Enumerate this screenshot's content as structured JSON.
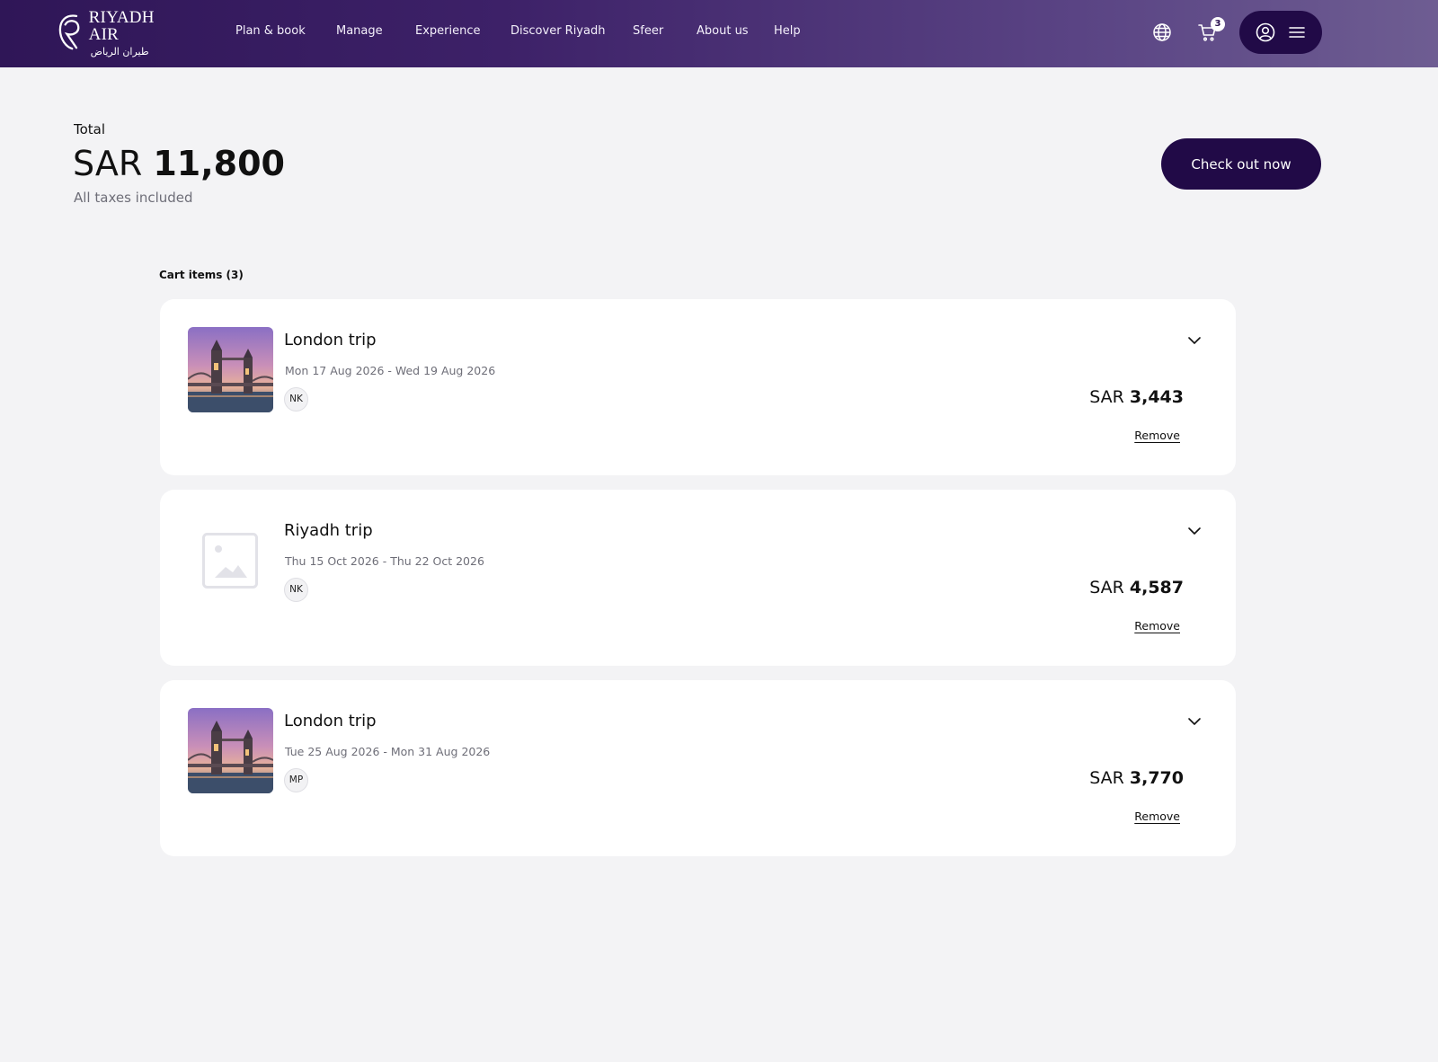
{
  "header": {
    "logo_text": "RIYADH AIR",
    "logo_arabic": "طيران الرياض",
    "nav": [
      {
        "label": "Plan & book"
      },
      {
        "label": "Manage"
      },
      {
        "label": "Experience"
      },
      {
        "label": "Discover Riyadh"
      },
      {
        "label": "Sfeer"
      },
      {
        "label": "About us"
      },
      {
        "label": "Help"
      }
    ],
    "cart_count": "3",
    "icons": [
      "globe-icon",
      "cart-icon",
      "user-icon",
      "menu-icon"
    ]
  },
  "summary": {
    "total_label": "Total",
    "currency": "SAR",
    "total_amount": "11,800",
    "taxes_note": "All taxes included",
    "checkout_label": "Check out now"
  },
  "cart": {
    "title": "Cart items (3)",
    "items": [
      {
        "name": "London trip",
        "dates": "Mon 17 Aug 2026 - Wed 19 Aug 2026",
        "traveler": "NK",
        "currency": "SAR",
        "price": "3,443",
        "remove_label": "Remove",
        "image": "tower-bridge-photo"
      },
      {
        "name": "Riyadh trip",
        "dates": "Thu 15 Oct 2026 - Thu 22 Oct 2026",
        "traveler": "NK",
        "currency": "SAR",
        "price": "4,587",
        "remove_label": "Remove",
        "image": "image-placeholder-icon"
      },
      {
        "name": "London trip",
        "dates": "Tue 25 Aug 2026 - Mon 31 Aug 2026",
        "traveler": "MP",
        "currency": "SAR",
        "price": "3,770",
        "remove_label": "Remove",
        "image": "tower-bridge-photo"
      }
    ]
  },
  "colors": {
    "header_gradient_start": "#2f1657",
    "header_gradient_end": "#6e5d92",
    "primary_button": "#210a47",
    "page_background": "#f3f3f5",
    "muted_text": "#6e6e78"
  }
}
